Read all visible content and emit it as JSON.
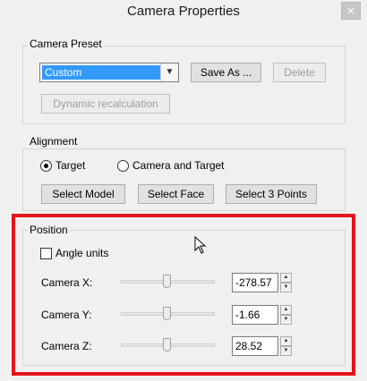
{
  "window": {
    "title": "Camera Properties",
    "close_glyph": "×"
  },
  "preset": {
    "group_label": "Camera Preset",
    "selected": "Custom",
    "save_as_label": "Save As ...",
    "delete_label": "Delete",
    "dynamic_label": "Dynamic recalculation"
  },
  "alignment": {
    "group_label": "Alignment",
    "target_label": "Target",
    "camera_target_label": "Camera and Target",
    "selected": "Target",
    "select_model_label": "Select Model",
    "select_face_label": "Select Face",
    "select_points_label": "Select 3 Points"
  },
  "position": {
    "group_label": "Position",
    "angle_units_label": "Angle units",
    "angle_units_checked": false,
    "camera_x": {
      "label": "Camera X:",
      "value": "-278.57"
    },
    "camera_y": {
      "label": "Camera Y:",
      "value": "-1.66"
    },
    "camera_z": {
      "label": "Camera Z:",
      "value": "28.52"
    }
  },
  "colors": {
    "highlight": "#e5161b",
    "selection": "#3399ff"
  }
}
